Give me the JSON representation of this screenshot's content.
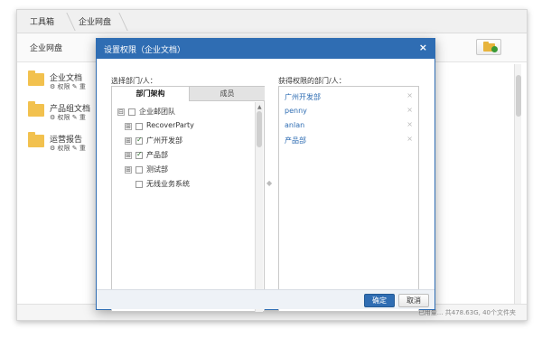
{
  "breadcrumb": {
    "root": "工具箱",
    "current": "企业网盘"
  },
  "header": {
    "title": "企业网盘"
  },
  "files": [
    {
      "name": "企业文档",
      "perm": "权限",
      "more": "重"
    },
    {
      "name": "产品组文档",
      "perm": "权限",
      "more": "重"
    },
    {
      "name": "运营报告",
      "perm": "权限",
      "more": "重"
    }
  ],
  "status": {
    "text": "已用量... 共478.63G, 40个文件夹"
  },
  "modal": {
    "title": "设置权限（企业文档）",
    "close": "×",
    "left_label": "选择部门/人：",
    "right_label": "获得权限的部门/人：",
    "tabs": {
      "org": "部门架构",
      "members": "成员"
    },
    "tree": [
      {
        "label": "企业邮团队",
        "expander": "⊟",
        "checked": false
      },
      {
        "label": "RecoverParty",
        "expander": "⊞",
        "checked": false
      },
      {
        "label": "广州开发部",
        "expander": "⊞",
        "checked": true
      },
      {
        "label": "产品部",
        "expander": "⊞",
        "checked": true
      },
      {
        "label": "测试部",
        "expander": "⊞",
        "checked": false
      },
      {
        "label": "无线业务系统",
        "expander": "",
        "checked": false
      }
    ],
    "selected": [
      {
        "name": "广州开发部",
        "remove": "×"
      },
      {
        "name": "penny",
        "remove": "×"
      },
      {
        "name": "anlan",
        "remove": "×"
      },
      {
        "name": "产品部",
        "remove": "×"
      }
    ],
    "ok": "确定",
    "cancel": "取消"
  }
}
